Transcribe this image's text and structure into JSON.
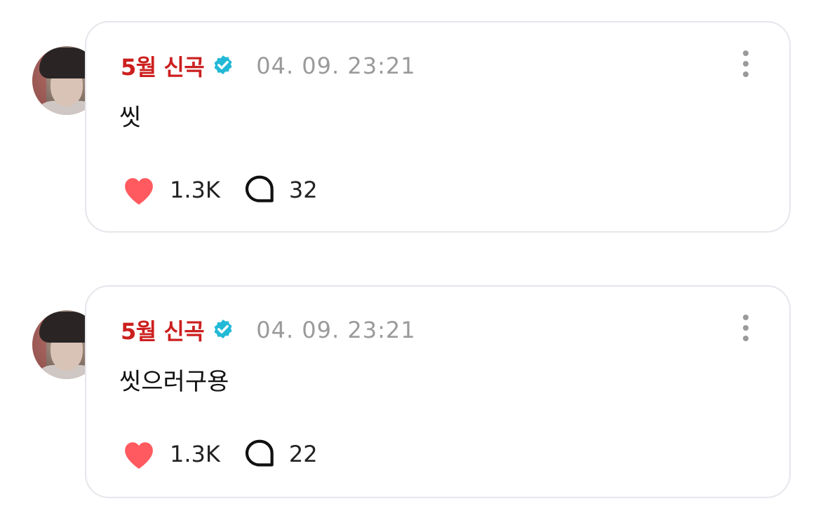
{
  "posts": [
    {
      "author": "5월 신곡",
      "verified": true,
      "timestamp": "04. 09. 23:21",
      "text": "씻",
      "likes": "1.3K",
      "comments": "32"
    },
    {
      "author": "5월 신곡",
      "verified": true,
      "timestamp": "04. 09. 23:21",
      "text": "씻으러구용",
      "likes": "1.3K",
      "comments": "22"
    }
  ],
  "icons": {
    "verified": "verified-badge-icon",
    "more": "more-vertical-icon",
    "like": "heart-icon",
    "comment": "comment-bubble-icon"
  },
  "colors": {
    "author": "#cc1f1f",
    "verified": "#21b9d6",
    "heart": "#ff5a5f",
    "meta": "#9a9a9a",
    "card_border": "#e6e6ec"
  }
}
